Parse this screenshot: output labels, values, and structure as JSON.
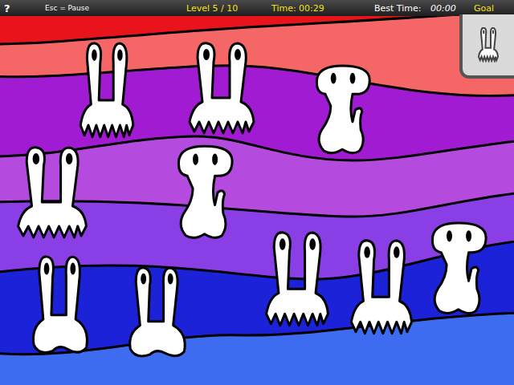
{
  "top_bar": {
    "help": "?",
    "pause_hint": "Esc = Pause",
    "level": "Level 5 / 10",
    "time": "Time: 00:29",
    "best_time_label": "Best Time:",
    "best_time": "00:00",
    "goal_label": "Goal"
  },
  "creatures": [
    {
      "kind": "fringe"
    },
    {
      "kind": "fringe"
    },
    {
      "kind": "head"
    },
    {
      "kind": "fringe"
    },
    {
      "kind": "head"
    },
    {
      "kind": "blob"
    },
    {
      "kind": "blob"
    },
    {
      "kind": "fringe"
    },
    {
      "kind": "fringe"
    },
    {
      "kind": "head"
    }
  ]
}
